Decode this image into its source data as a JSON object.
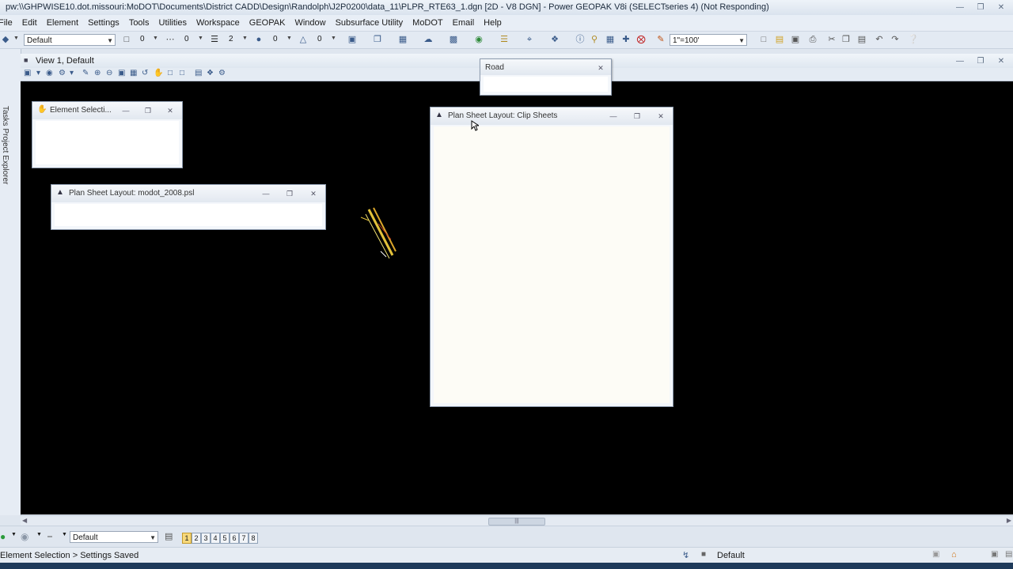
{
  "window": {
    "title": "pw:\\\\GHPWISE10.dot.missouri:MoDOT\\Documents\\District CADD\\Design\\Randolph\\J2P0200\\data_11\\PLPR_RTE63_1.dgn [2D - V8 DGN] - Power GEOPAK V8i (SELECTseries 4) (Not Responding)"
  },
  "menu": [
    "File",
    "Edit",
    "Element",
    "Settings",
    "Tools",
    "Utilities",
    "Workspace",
    "GEOPAK",
    "Window",
    "Subsurface Utility",
    "MoDOT",
    "Email",
    "Help"
  ],
  "toolbar": {
    "level_value": "Default",
    "color_value": "0",
    "style_value": "0",
    "weight_value": "2",
    "transparency_value": "0",
    "priority_value": "0",
    "scale_value": "1\"=100'"
  },
  "left_strip": {
    "tabs_label": "Tasks  Project Explorer"
  },
  "view": {
    "title": "View 1, Default"
  },
  "dialogs": {
    "road": {
      "title": "Road"
    },
    "element_selection": {
      "title": "Element Selecti..."
    },
    "plan_sheet_modot": {
      "title": "Plan Sheet Layout: modot_2008.psl"
    },
    "plan_sheet_clip": {
      "title": "Plan Sheet Layout: Clip Sheets"
    }
  },
  "view_bar": {
    "level_value": "Default",
    "views": [
      "1",
      "2",
      "3",
      "4",
      "5",
      "6",
      "7",
      "8"
    ],
    "active_view": "1"
  },
  "status": {
    "message": "Element Selection > Settings Saved",
    "active_level": "Default"
  },
  "colors": {
    "canvas": "#000000",
    "ui_background": "#dfe6ef",
    "active_view_button": "#f7d87a"
  }
}
